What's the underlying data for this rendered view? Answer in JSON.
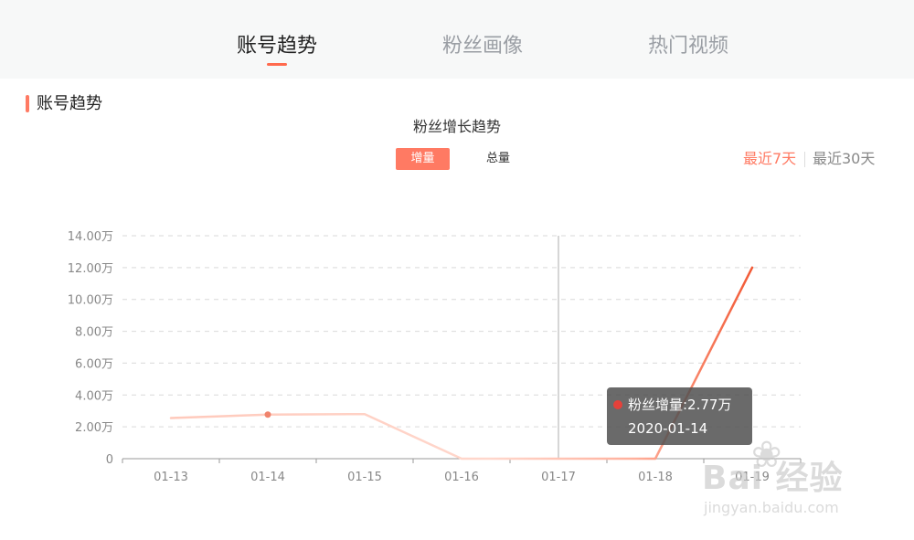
{
  "nav": {
    "tabs": [
      {
        "label": "账号趋势",
        "active": true
      },
      {
        "label": "粉丝画像",
        "active": false
      },
      {
        "label": "热门视频",
        "active": false
      }
    ]
  },
  "section": {
    "title": "账号趋势"
  },
  "toggle": {
    "increment_label": "增量",
    "total_label": "总量",
    "selected": "增量"
  },
  "range": {
    "last7_label": "最近7天",
    "last30_label": "最近30天",
    "selected": "最近7天"
  },
  "colors": {
    "accent": "#ff7a63",
    "line_light": "#ffc9bb",
    "line_dark": "#f25a36",
    "tooltip_dot": "#e5413a"
  },
  "tooltip": {
    "series_label": "粉丝增量:2.77万",
    "date_label": "2020-01-14"
  },
  "watermark": {
    "brand": "Bai 经验",
    "url": "jingyan.baidu.com",
    "icon": "baidu-paw-icon"
  },
  "chart_data": {
    "type": "line",
    "title": "粉丝增长趋势",
    "categories": [
      "01-13",
      "01-14",
      "01-15",
      "01-16",
      "01-17",
      "01-18",
      "01-19"
    ],
    "series": [
      {
        "values": [
          2.55,
          2.77,
          2.8,
          0,
          0,
          0,
          12.0
        ]
      }
    ],
    "yticks": [
      "0",
      "2.00万",
      "4.00万",
      "6.00万",
      "8.00万",
      "10.00万",
      "12.00万",
      "14.00万"
    ],
    "ylim": [
      0,
      14
    ],
    "y_unit": "万",
    "grid": true,
    "highlight_index": 1,
    "cursor_index": 4,
    "xlabel": "",
    "ylabel": ""
  }
}
